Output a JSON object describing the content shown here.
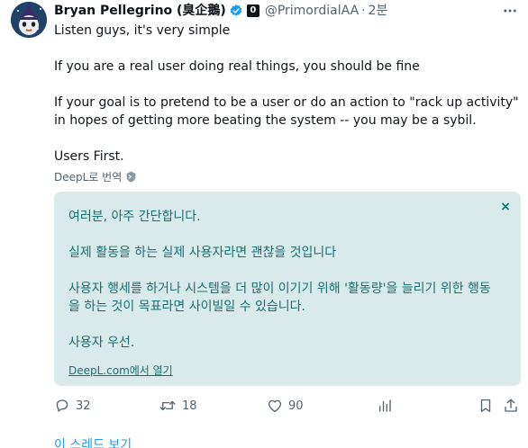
{
  "author": {
    "display_name": "Bryan Pellegrino (臭企鵝)",
    "handle": "@PrimordialAA",
    "separator": "·",
    "time": "2분",
    "affiliate_badge": "0",
    "verified": true,
    "verified_color": "#1d9bf0"
  },
  "tweet": {
    "paragraphs": [
      "Listen guys, it's very simple",
      "If you are a real user doing real things, you should be fine",
      "If your goal is to pretend to be a user or do an action to \"rack up activity\" in hopes of getting more beating the system -- you may be a sybil.",
      "Users First."
    ]
  },
  "translate": {
    "label": "DeepL로 번역",
    "close_glyph": "×",
    "paragraphs": [
      "여러분, 아주 간단합니다.",
      "실제 활동을 하는 실제 사용자라면 괜찮을 것입니다",
      "사용자 행세를 하거나 시스템을 더 많이 이기기 위해 '활동량'을 늘리기 위한 행동을 하는 것이 목표라면 사이빌일 수 있습니다.",
      "사용자 우선."
    ],
    "source_link": "DeepL.com에서 열기",
    "box_color": "#d8eaea",
    "text_color": "#1a6e73"
  },
  "actions": {
    "reply_count": "32",
    "retweet_count": "18",
    "like_count": "90"
  },
  "thread_link": "이 스레드 보기",
  "icons": {
    "more": "more-horizontal-icon",
    "reply": "reply-icon",
    "retweet": "retweet-icon",
    "like": "heart-icon",
    "views": "analytics-icon",
    "bookmark": "bookmark-icon",
    "share": "share-icon",
    "shield": "shield-icon",
    "verified": "verified-badge-icon"
  },
  "colors": {
    "accent": "#1d9bf0",
    "muted": "#536471",
    "text": "#0f1419"
  }
}
